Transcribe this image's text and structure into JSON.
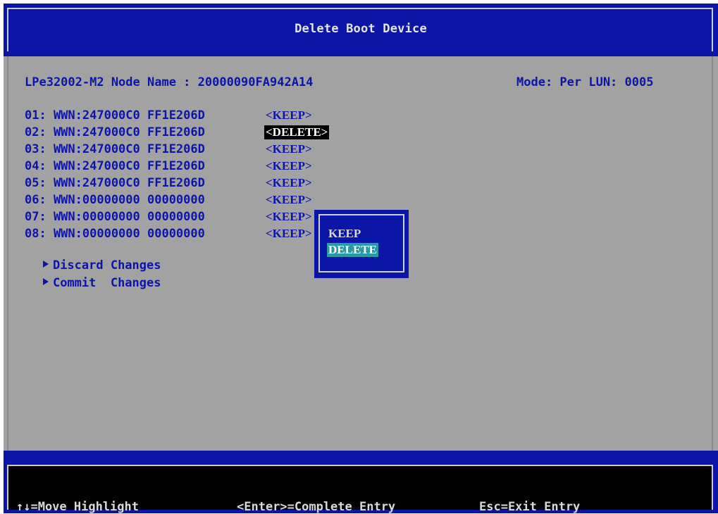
{
  "title": "Delete Boot Device",
  "header": {
    "node_name": "LPe32002-M2 Node Name : 20000090FA942A14",
    "mode": "Mode: Per LUN: 0005"
  },
  "entries": [
    {
      "label": "01: WWN:247000C0 FF1E206D",
      "action": "<KEEP>"
    },
    {
      "label": "02: WWN:247000C0 FF1E206D",
      "action": "<DELETE>"
    },
    {
      "label": "03: WWN:247000C0 FF1E206D",
      "action": "<KEEP>"
    },
    {
      "label": "04: WWN:247000C0 FF1E206D",
      "action": "<KEEP>"
    },
    {
      "label": "05: WWN:247000C0 FF1E206D",
      "action": "<KEEP>"
    },
    {
      "label": "06: WWN:00000000 00000000",
      "action": "<KEEP>"
    },
    {
      "label": "07: WWN:00000000 00000000",
      "action": "<KEEP>"
    },
    {
      "label": "08: WWN:00000000 00000000",
      "action": "<KEEP>"
    }
  ],
  "menu": {
    "discard": "Discard Changes",
    "commit": "Commit  Changes"
  },
  "popup": {
    "options": [
      "KEEP",
      "DELETE"
    ],
    "selected": "DELETE"
  },
  "footer": {
    "move": "↑↓=Move Highlight",
    "enter": "<Enter>=Complete Entry",
    "esc": "Esc=Exit Entry"
  },
  "colors": {
    "background": "#a2a2a2",
    "bar": "#0c16a6",
    "text": "#0d14a8",
    "highlight": "#2a9aa6"
  }
}
